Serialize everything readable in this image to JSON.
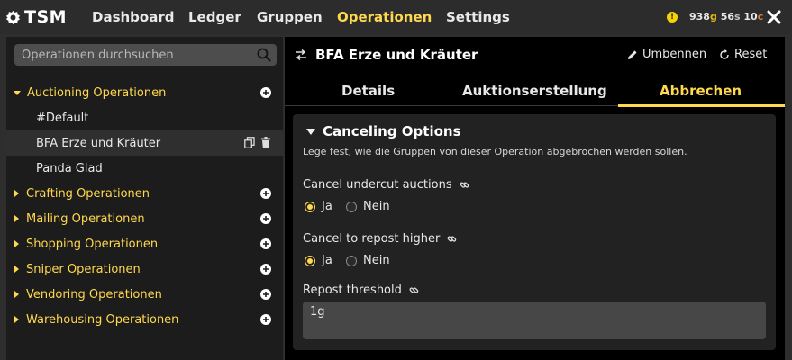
{
  "app": {
    "logo_text": "TSM",
    "nav": [
      {
        "label": "Dashboard",
        "active": false
      },
      {
        "label": "Ledger",
        "active": false
      },
      {
        "label": "Gruppen",
        "active": false
      },
      {
        "label": "Operationen",
        "active": true
      },
      {
        "label": "Settings",
        "active": false
      }
    ],
    "status_icon": "!",
    "gold": {
      "g": "938",
      "g_unit": "g",
      "s": "56",
      "s_unit": "s",
      "c": "10",
      "c_unit": "c"
    },
    "colors": {
      "accent": "#ffd84d",
      "gold": "#e9b80b",
      "silver": "#c6c6c6",
      "copper": "#d9823b"
    }
  },
  "sidebar": {
    "search_placeholder": "Operationen durchsuchen",
    "groups": [
      {
        "label": "Auctioning Operationen",
        "expanded": true
      },
      {
        "label": "Crafting Operationen",
        "expanded": false
      },
      {
        "label": "Mailing Operationen",
        "expanded": false
      },
      {
        "label": "Shopping Operationen",
        "expanded": false
      },
      {
        "label": "Sniper Operationen",
        "expanded": false
      },
      {
        "label": "Vendoring Operationen",
        "expanded": false
      },
      {
        "label": "Warehousing Operationen",
        "expanded": false
      }
    ],
    "operations": [
      {
        "label": "#Default",
        "selected": false
      },
      {
        "label": "BFA Erze und Kräuter",
        "selected": true
      },
      {
        "label": "Panda Glad",
        "selected": false
      }
    ]
  },
  "main": {
    "title": "BFA Erze und Kräuter",
    "rename_label": "Umbennen",
    "reset_label": "Reset",
    "tabs": [
      {
        "label": "Details",
        "active": false
      },
      {
        "label": "Auktionserstellung",
        "active": false
      },
      {
        "label": "Abbrechen",
        "active": true
      }
    ],
    "section": {
      "title": "Canceling Options",
      "description": "Lege fest, wie die Gruppen von dieser Operation abgebrochen werden sollen.",
      "settings": [
        {
          "label": "Cancel undercut auctions",
          "yes": "Ja",
          "no": "Nein",
          "value": "Ja"
        },
        {
          "label": "Cancel to repost higher",
          "yes": "Ja",
          "no": "Nein",
          "value": "Ja"
        }
      ],
      "threshold_label": "Repost threshold",
      "threshold_value": "1g"
    }
  }
}
